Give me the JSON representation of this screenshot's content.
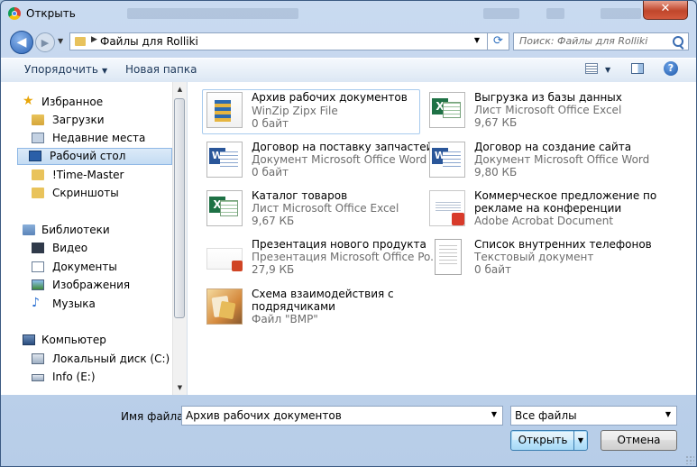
{
  "window": {
    "title": "Открыть",
    "close_glyph": "✕"
  },
  "address": {
    "path": "Файлы для Rolliki",
    "search_placeholder": "Поиск: Файлы для Rolliki"
  },
  "toolbar": {
    "organize_label": "Упорядочить",
    "new_folder_label": "Новая папка"
  },
  "sidebar": {
    "favorites": {
      "label": "Избранное",
      "items": [
        {
          "label": "Загрузки",
          "icon": "downloads-folder-icon"
        },
        {
          "label": "Недавние места",
          "icon": "recent-places-icon"
        },
        {
          "label": "Рабочий стол",
          "icon": "desktop-icon"
        },
        {
          "label": "!Time-Master",
          "icon": "folder-icon"
        },
        {
          "label": "Скриншоты",
          "icon": "folder-icon"
        }
      ]
    },
    "libraries": {
      "label": "Библиотеки",
      "items": [
        {
          "label": "Видео",
          "icon": "video-library-icon"
        },
        {
          "label": "Документы",
          "icon": "documents-library-icon"
        },
        {
          "label": "Изображения",
          "icon": "pictures-library-icon"
        },
        {
          "label": "Музыка",
          "icon": "music-library-icon"
        }
      ]
    },
    "computer": {
      "label": "Компьютер",
      "items": [
        {
          "label": "Локальный диск (C:)",
          "icon": "local-disk-icon"
        },
        {
          "label": "Info (E:)",
          "icon": "drive-icon"
        }
      ]
    },
    "selected": "Рабочий стол"
  },
  "files": [
    {
      "name": "Архив рабочих документов",
      "type": "WinZip Zipx File",
      "size": "0 байт",
      "icon": "zip-archive-icon"
    },
    {
      "name": "Выгрузка из базы данных",
      "type": "Лист Microsoft Office Excel",
      "size": "9,67 КБ",
      "icon": "excel-file-icon"
    },
    {
      "name": "Договор на поставку запчастей",
      "type": "Документ Microsoft Office Word",
      "size": "0 байт",
      "icon": "word-file-icon"
    },
    {
      "name": "Договор на создание сайта",
      "type": "Документ Microsoft Office Word",
      "size": "9,80 КБ",
      "icon": "word-file-icon"
    },
    {
      "name": "Каталог товаров",
      "type": "Лист Microsoft Office Excel",
      "size": "9,67 КБ",
      "icon": "excel-file-icon"
    },
    {
      "name_line1": "Коммерческое предложение по",
      "name_line2": "рекламе на конференции",
      "type": "Adobe Acrobat Document",
      "icon": "pdf-file-icon"
    },
    {
      "name": "Презентация нового продукта",
      "type": "Презентация Microsoft Office Po...",
      "size": "27,9 КБ",
      "icon": "powerpoint-file-icon"
    },
    {
      "name": "Список внутренних телефонов",
      "type": "Текстовый документ",
      "size": "0 байт",
      "icon": "text-file-icon"
    },
    {
      "name_line1": "Схема взаимодействия с",
      "name_line2": "подрядчиками",
      "type": "Файл \"BMP\"",
      "icon": "bmp-image-icon"
    }
  ],
  "footer": {
    "filename_label": "Имя файла:",
    "filename_value": "Архив рабочих документов",
    "filetype_value": "Все файлы",
    "open_label": "Открыть",
    "cancel_label": "Отмена"
  },
  "colors": {
    "accent": "#3c7fb1",
    "selection": "#c4dcf3",
    "window_frame": "#b7cde8"
  }
}
